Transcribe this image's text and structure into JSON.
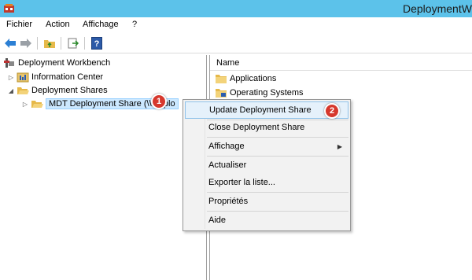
{
  "window": {
    "title": "DeploymentW"
  },
  "menubar": {
    "items": [
      "Fichier",
      "Action",
      "Affichage",
      "?"
    ]
  },
  "toolbar": {
    "buttons": [
      "back-icon",
      "forward-icon",
      "up-folder-icon",
      "export-icon",
      "help-icon"
    ]
  },
  "tree": {
    "root": "Deployment Workbench",
    "nodes": [
      {
        "label": "Information Center",
        "expanded": false
      },
      {
        "label": "Deployment Shares",
        "expanded": true
      },
      {
        "label": "MDT Deployment Share (\\\\...eplo",
        "expanded": false,
        "selected": true
      }
    ]
  },
  "list": {
    "column_header": "Name",
    "items": [
      "Applications",
      "Operating Systems"
    ]
  },
  "context_menu": {
    "items": [
      "Update Deployment Share",
      "Close Deployment Share",
      "Affichage",
      "Actualiser",
      "Exporter la liste...",
      "Propriétés",
      "Aide"
    ]
  },
  "annotations": [
    "1",
    "2"
  ],
  "colors": {
    "titlebar": "#5cc2ea",
    "badge": "#d6382d",
    "highlight": "#e5f1fb"
  }
}
